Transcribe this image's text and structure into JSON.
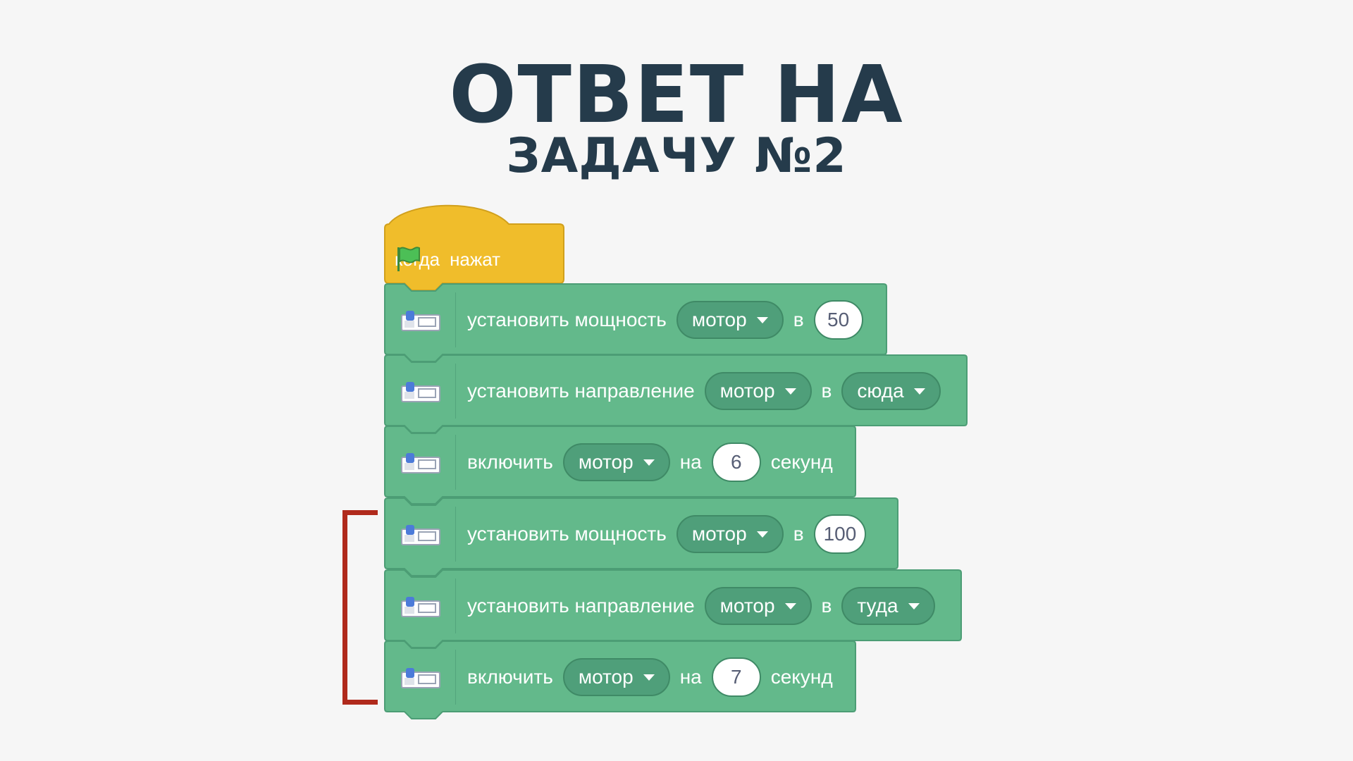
{
  "title": {
    "line1": "ОТВЕТ НА",
    "line2": "ЗАДАЧУ №2"
  },
  "colors": {
    "title": "#253b4b",
    "hat_block": "#f0bd2b",
    "motion_block": "#63b98b",
    "dropdown": "#4f9f7a",
    "bracket": "#b02a1c"
  },
  "hat": {
    "when_label": "когда",
    "flag_icon": "green-flag-icon",
    "clicked_label": "нажат"
  },
  "blocks": [
    {
      "label": "установить мощность",
      "dropdown": "мотор",
      "mid": "в",
      "value": "50"
    },
    {
      "label": "установить направление",
      "dropdown": "мотор",
      "mid": "в",
      "dropdown2": "сюда"
    },
    {
      "label": "включить",
      "dropdown": "мотор",
      "mid": "на",
      "value": "6",
      "suffix": "секунд"
    },
    {
      "label": "установить мощность",
      "dropdown": "мотор",
      "mid": "в",
      "value": "100"
    },
    {
      "label": "установить направление",
      "dropdown": "мотор",
      "mid": "в",
      "dropdown2": "туда"
    },
    {
      "label": "включить",
      "dropdown": "мотор",
      "mid": "на",
      "value": "7",
      "suffix": "секунд"
    }
  ]
}
